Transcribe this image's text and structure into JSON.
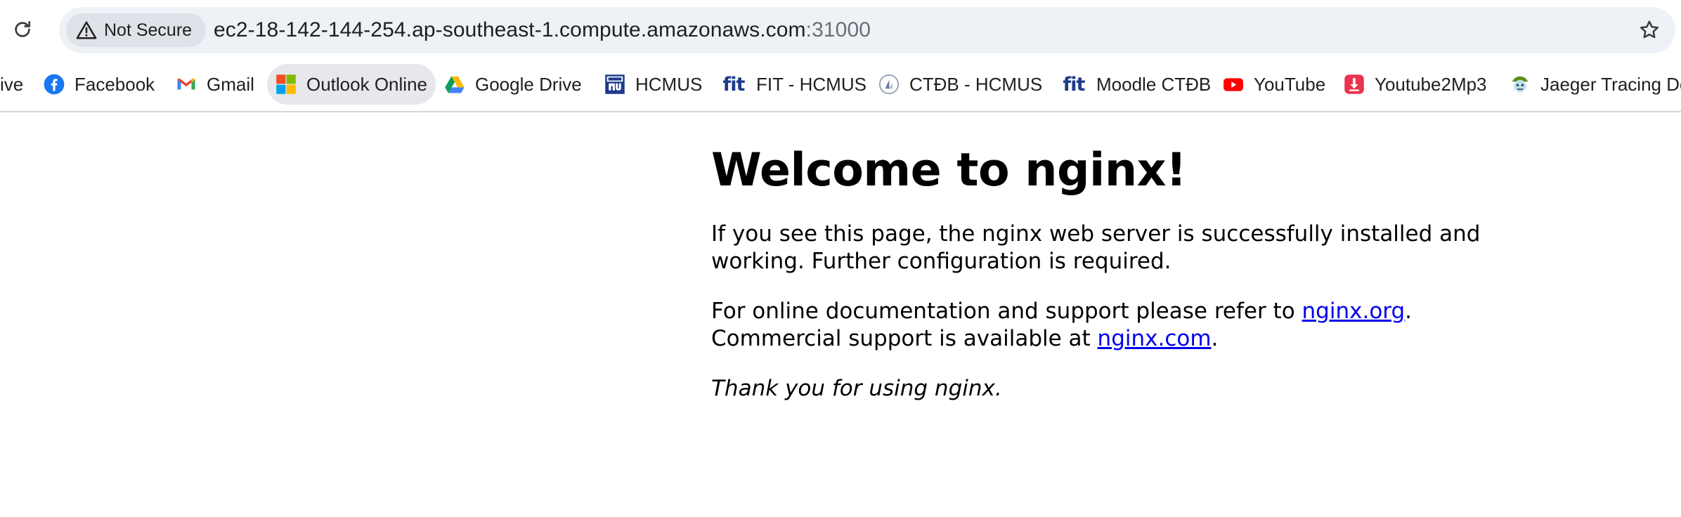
{
  "browser": {
    "security_label": "Not Secure",
    "url_host": "ec2-18-142-144-254.ap-southeast-1.compute.amazonaws.com",
    "url_port": ":31000",
    "icons": {
      "reload": "reload-icon",
      "warning": "warning-triangle-icon",
      "bookmark_star": "star-outline-icon"
    }
  },
  "bookmarks": [
    {
      "label": "ive",
      "icon": "none"
    },
    {
      "label": "Facebook",
      "icon": "facebook-icon",
      "color": "#1877f2"
    },
    {
      "label": "Gmail",
      "icon": "gmail-icon"
    },
    {
      "label": "Outlook Online",
      "icon": "microsoft-icon",
      "active": true
    },
    {
      "label": "Google Drive",
      "icon": "google-drive-icon"
    },
    {
      "label": "HCMUS",
      "icon": "hcmus-icon",
      "color": "#1e3a8a"
    },
    {
      "label": "FIT - HCMUS",
      "icon": "fit-icon",
      "color": "#1e3a8a"
    },
    {
      "label": "CTĐB - HCMUS",
      "icon": "ctdb-icon"
    },
    {
      "label": "Moodle CTĐB",
      "icon": "fit-icon",
      "color": "#1e3a8a"
    },
    {
      "label": "YouTube",
      "icon": "youtube-icon",
      "color": "#ff0000"
    },
    {
      "label": "Youtube2Mp3",
      "icon": "download-icon",
      "color": "#e8344e"
    },
    {
      "label": "Jaeger Tracing Do",
      "icon": "jaeger-icon"
    }
  ],
  "page": {
    "heading": "Welcome to nginx!",
    "p1": "If you see this page, the nginx web server is successfully installed and working. Further configuration is required.",
    "p2_pre": "For online documentation and support please refer to ",
    "p2_link1": "nginx.org",
    "p2_mid": ".",
    "p2_line2_pre": "Commercial support is available at ",
    "p2_link2": "nginx.com",
    "p2_post": ".",
    "p3": "Thank you for using nginx."
  },
  "colors": {
    "link": "#0000ee",
    "chip_bg": "#dfe2e8",
    "omnibox_bg": "#eef1f6"
  }
}
